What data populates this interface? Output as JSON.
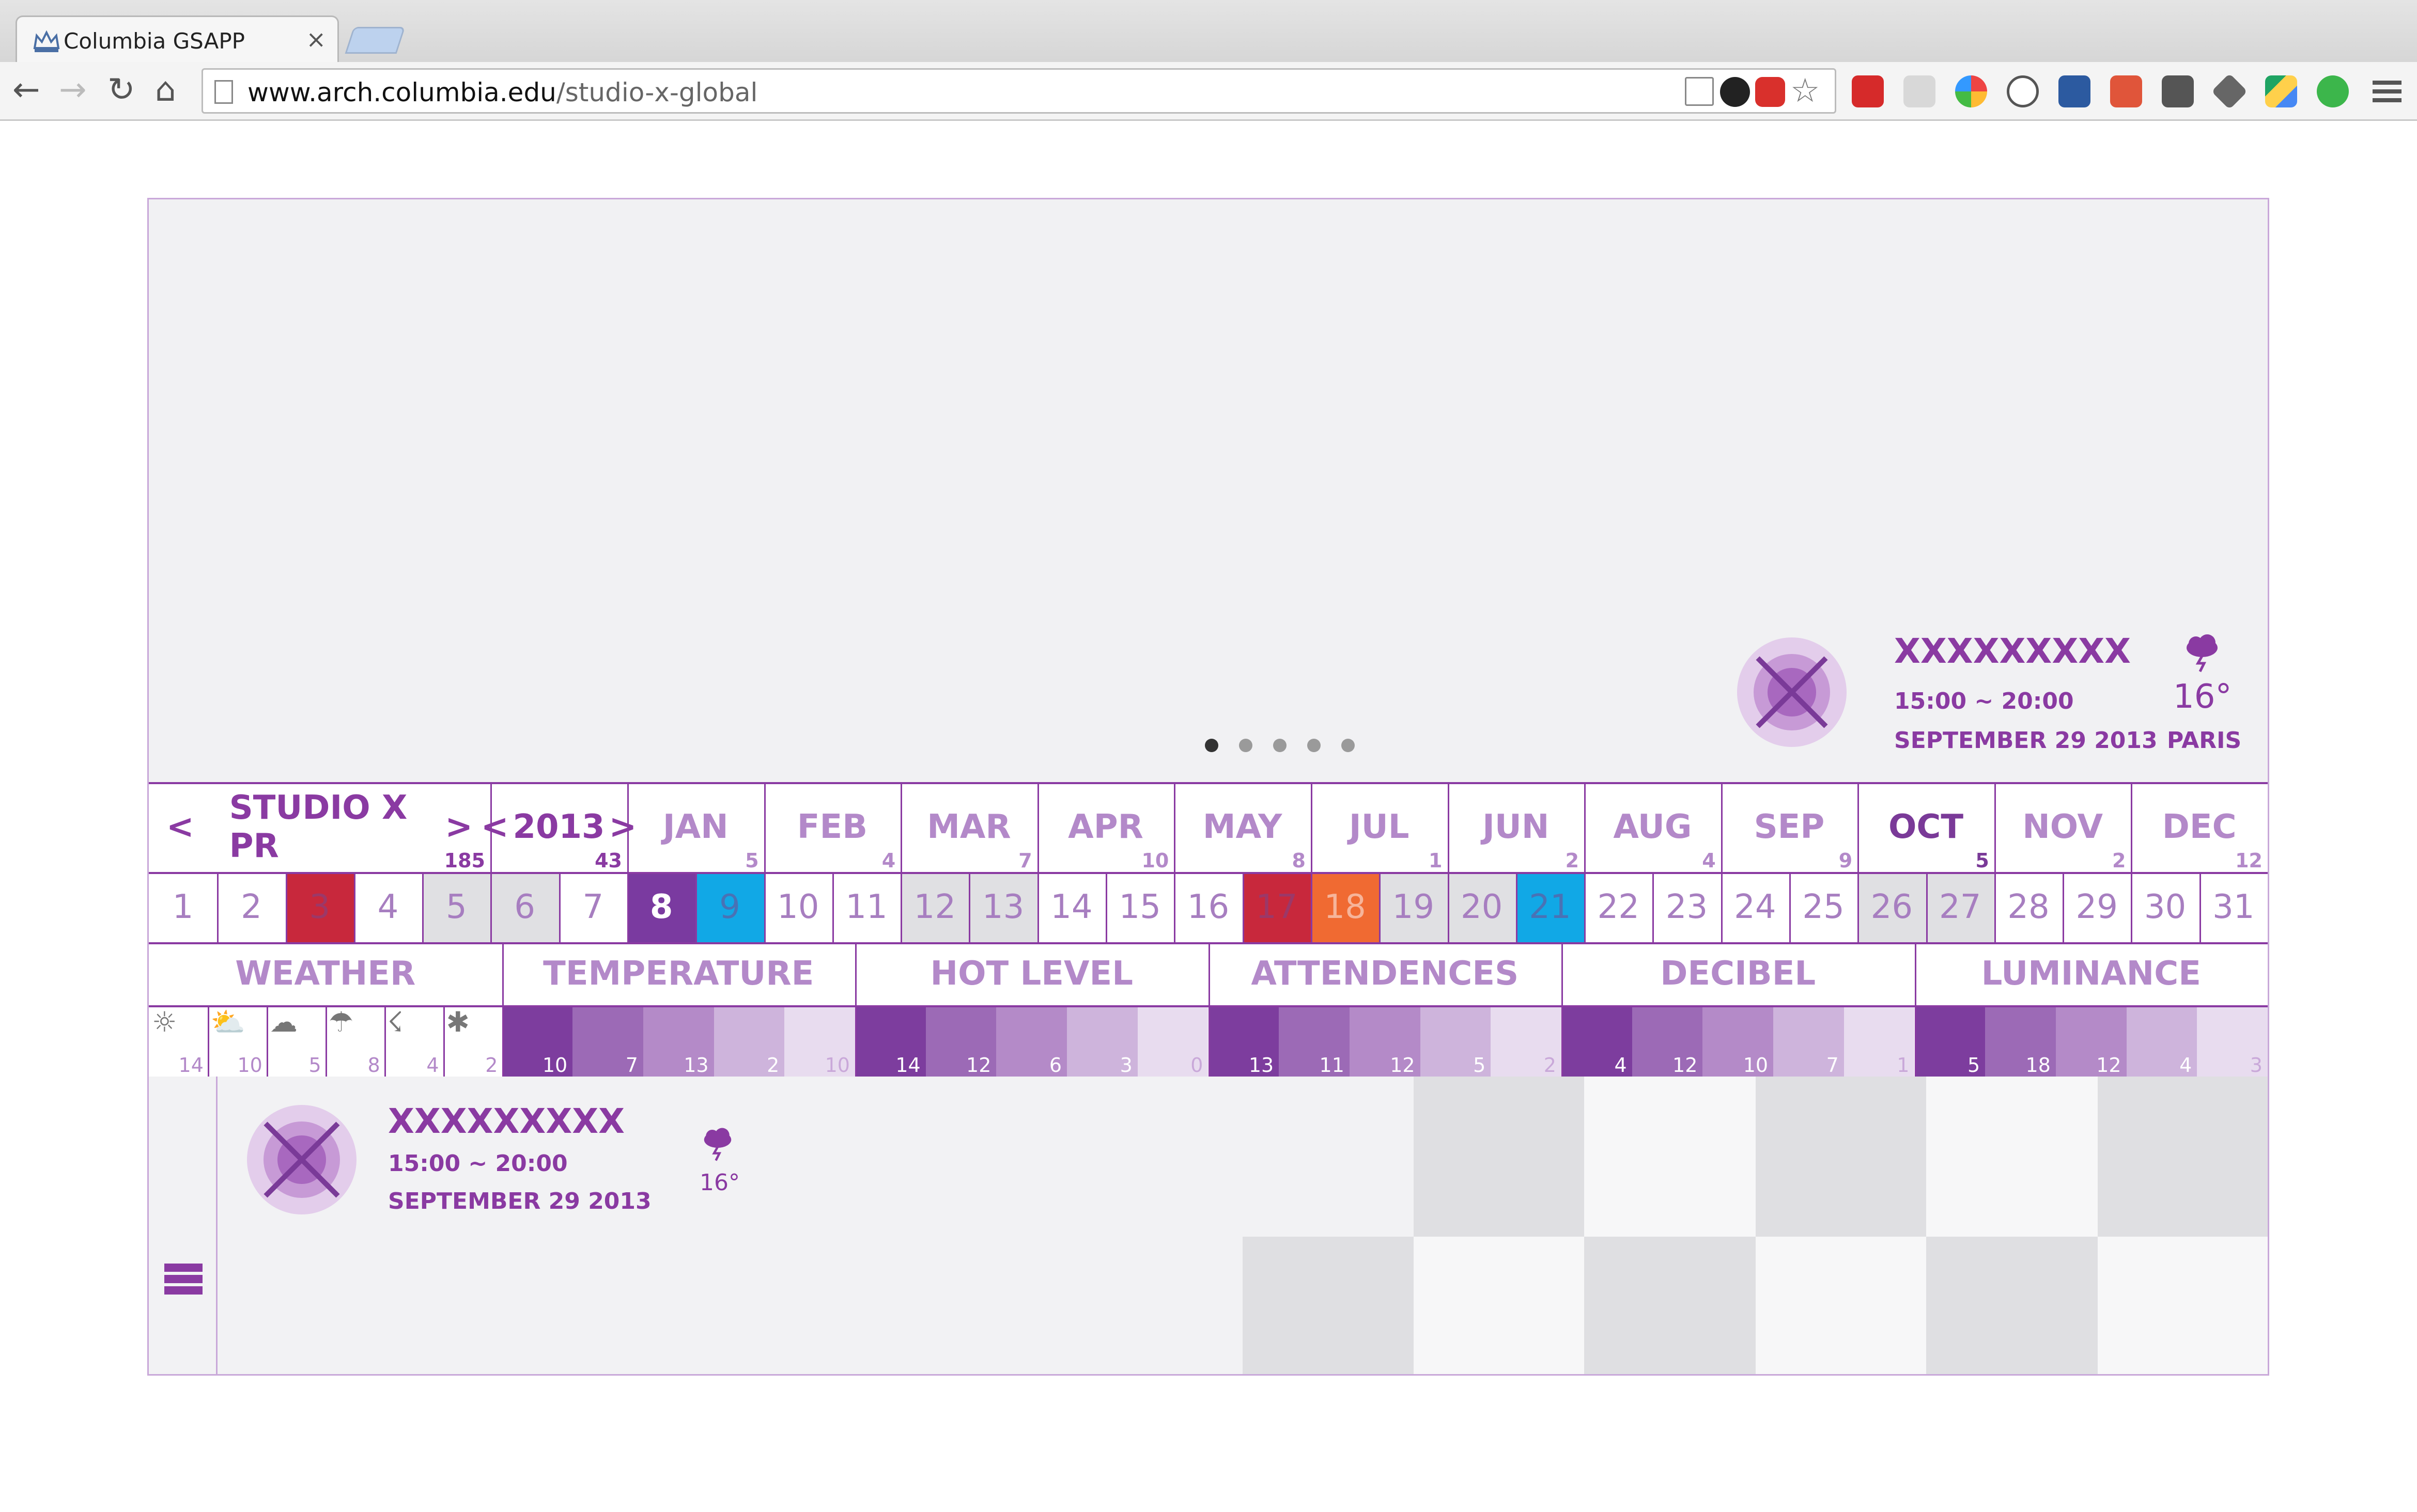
{
  "browser": {
    "tab_title": "Columbia GSAPP",
    "tab_close": "×",
    "url_host": "www.arch.columbia.edu",
    "url_path": "/studio-x-global",
    "nav": {
      "back": "←",
      "forward": "→",
      "reload": "↻",
      "home": "⌂"
    }
  },
  "hero": {
    "slides": 5,
    "active_slide": 1,
    "event": {
      "title": "XXXXXXXXX",
      "time": "15:00 ~ 20:00",
      "date": "SEPTEMBER 29 2013",
      "temperature": "16°",
      "city": "PARIS",
      "weather_icon": "storm-cloud-icon"
    }
  },
  "calendar": {
    "studio": {
      "prev": "<",
      "label": "STUDIO X PR",
      "next": ">",
      "count": "185"
    },
    "year": {
      "prev": "<",
      "label": "2013",
      "next": ">",
      "count": "43"
    },
    "months": [
      {
        "label": "JAN",
        "count": "5"
      },
      {
        "label": "FEB",
        "count": "4"
      },
      {
        "label": "MAR",
        "count": "7"
      },
      {
        "label": "APR",
        "count": "10"
      },
      {
        "label": "MAY",
        "count": "8"
      },
      {
        "label": "JUL",
        "count": "1"
      },
      {
        "label": "JUN",
        "count": "2"
      },
      {
        "label": "AUG",
        "count": "4"
      },
      {
        "label": "SEP",
        "count": "9"
      },
      {
        "label": "OCT",
        "count": "5"
      },
      {
        "label": "NOV",
        "count": "2"
      },
      {
        "label": "DEC",
        "count": "12"
      }
    ],
    "active_month": "OCT",
    "days": [
      {
        "label": "1",
        "state": "plain"
      },
      {
        "label": "2",
        "state": "plain"
      },
      {
        "label": "3",
        "state": "red"
      },
      {
        "label": "4",
        "state": "plain"
      },
      {
        "label": "5",
        "state": "grey"
      },
      {
        "label": "6",
        "state": "grey"
      },
      {
        "label": "7",
        "state": "plain"
      },
      {
        "label": "8",
        "state": "selected"
      },
      {
        "label": "9",
        "state": "blue"
      },
      {
        "label": "10",
        "state": "plain"
      },
      {
        "label": "11",
        "state": "plain"
      },
      {
        "label": "12",
        "state": "grey"
      },
      {
        "label": "13",
        "state": "grey"
      },
      {
        "label": "14",
        "state": "plain"
      },
      {
        "label": "15",
        "state": "plain"
      },
      {
        "label": "16",
        "state": "plain"
      },
      {
        "label": "17",
        "state": "red"
      },
      {
        "label": "18",
        "state": "orange"
      },
      {
        "label": "19",
        "state": "grey"
      },
      {
        "label": "20",
        "state": "grey"
      },
      {
        "label": "21",
        "state": "blue"
      },
      {
        "label": "22",
        "state": "plain"
      },
      {
        "label": "23",
        "state": "plain"
      },
      {
        "label": "24",
        "state": "plain"
      },
      {
        "label": "25",
        "state": "plain"
      },
      {
        "label": "26",
        "state": "grey"
      },
      {
        "label": "27",
        "state": "grey"
      },
      {
        "label": "28",
        "state": "plain"
      },
      {
        "label": "29",
        "state": "plain"
      },
      {
        "label": "30",
        "state": "plain"
      },
      {
        "label": "31",
        "state": "plain"
      }
    ],
    "day_colors": {
      "red": "#c8283c",
      "orange": "#f06a32",
      "blue": "#11a8e6",
      "selected": "#7a3aa0",
      "grey": "#e0e0e3"
    },
    "categories": [
      {
        "label": "WEATHER"
      },
      {
        "label": "TEMPERATURE"
      },
      {
        "label": "HOT LEVEL"
      },
      {
        "label": "ATTENDENCES"
      },
      {
        "label": "DECIBEL"
      },
      {
        "label": "LUMINANCE"
      }
    ],
    "weather": [
      {
        "icon": "sun-icon",
        "glyph": "☼",
        "value": "14"
      },
      {
        "icon": "partly-cloudy-icon",
        "glyph": "⛅",
        "value": "10"
      },
      {
        "icon": "cloud-icon",
        "glyph": "☁",
        "value": "5"
      },
      {
        "icon": "rain-icon",
        "glyph": "☂",
        "value": "8"
      },
      {
        "icon": "thunder-icon",
        "glyph": "☇",
        "value": "4"
      },
      {
        "icon": "snow-icon",
        "glyph": "✱",
        "value": "2"
      }
    ],
    "bars": [
      {
        "name": "temperature",
        "values": [
          "10",
          "7",
          "13",
          "2",
          "10"
        ]
      },
      {
        "name": "hot-level",
        "values": [
          "14",
          "12",
          "6",
          "3",
          "0"
        ]
      },
      {
        "name": "attendences",
        "values": [
          "13",
          "11",
          "12",
          "5",
          "2"
        ]
      },
      {
        "name": "decibel",
        "values": [
          "4",
          "12",
          "10",
          "7",
          "1"
        ]
      },
      {
        "name": "luminance",
        "values": [
          "5",
          "18",
          "12",
          "4",
          "3"
        ]
      }
    ],
    "bar_shades": [
      "#7d3d9e",
      "#9c6ab6",
      "#b48ac8",
      "#ceb4dc",
      "#e8dcef"
    ]
  },
  "detail": {
    "title": "XXXXXXXXX",
    "time": "15:00 ~ 20:00",
    "date": "SEPTEMBER 29 2013",
    "temperature": "16°",
    "weather_icon": "storm-cloud-icon"
  },
  "colors": {
    "accent": "#8a3aa2",
    "accent_light": "#b389c9"
  }
}
